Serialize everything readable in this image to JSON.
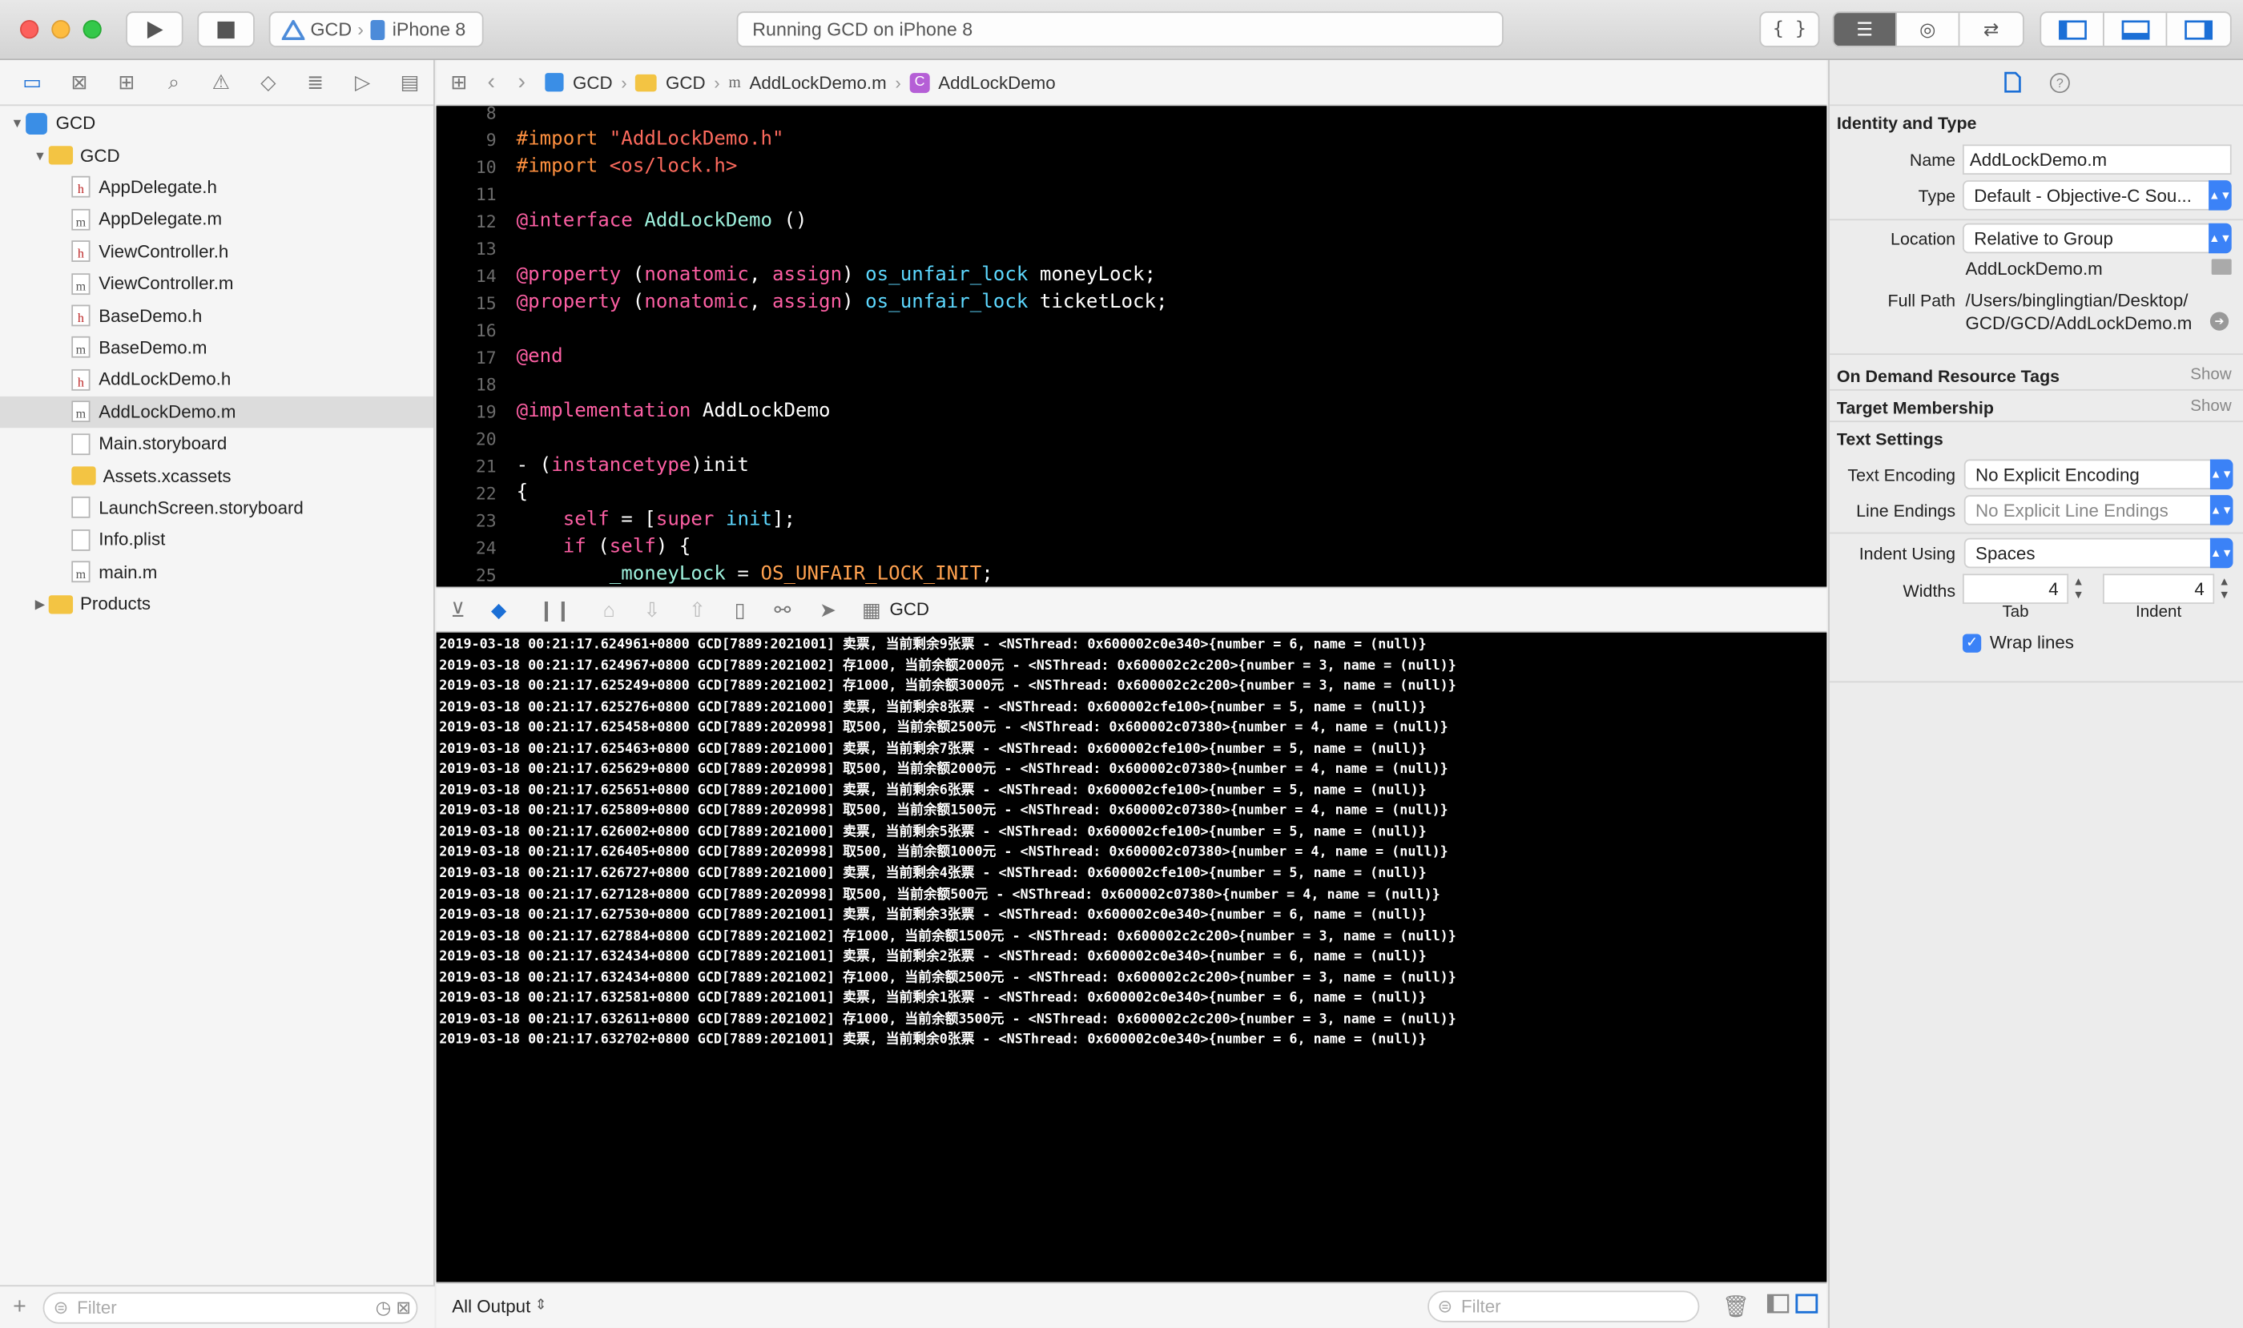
{
  "toolbar": {
    "scheme": "GCD",
    "device": "iPhone 8",
    "status": "Running GCD on iPhone 8"
  },
  "jumpbar": {
    "project": "GCD",
    "group": "GCD",
    "file": "AddLockDemo.m",
    "symbol": "AddLockDemo"
  },
  "navigator": {
    "rows": [
      {
        "label": "GCD",
        "kind": "project",
        "level": 0
      },
      {
        "label": "GCD",
        "kind": "folder",
        "level": 1
      },
      {
        "label": "AppDelegate.h",
        "kind": "h",
        "level": 2
      },
      {
        "label": "AppDelegate.m",
        "kind": "m",
        "level": 2
      },
      {
        "label": "ViewController.h",
        "kind": "h",
        "level": 2
      },
      {
        "label": "ViewController.m",
        "kind": "m",
        "level": 2
      },
      {
        "label": "BaseDemo.h",
        "kind": "h",
        "level": 2
      },
      {
        "label": "BaseDemo.m",
        "kind": "m",
        "level": 2
      },
      {
        "label": "AddLockDemo.h",
        "kind": "h",
        "level": 2
      },
      {
        "label": "AddLockDemo.m",
        "kind": "m",
        "level": 2,
        "selected": true
      },
      {
        "label": "Main.storyboard",
        "kind": "sb",
        "level": 2
      },
      {
        "label": "Assets.xcassets",
        "kind": "folder",
        "level": 2
      },
      {
        "label": "LaunchScreen.storyboard",
        "kind": "sb",
        "level": 2
      },
      {
        "label": "Info.plist",
        "kind": "sb",
        "level": 2
      },
      {
        "label": "main.m",
        "kind": "m",
        "level": 2
      },
      {
        "label": "Products",
        "kind": "folder",
        "level": 1,
        "collapsed": true
      }
    ],
    "filter_placeholder": "Filter"
  },
  "editor": {
    "lines": [
      {
        "n": "8",
        "code": ""
      },
      {
        "n": "9",
        "code": "<span class='pp'>#import</span> <span class='s'>\"AddLockDemo.h\"</span>"
      },
      {
        "n": "10",
        "code": "<span class='pp'>#import</span> <span class='s'>&lt;os/lock.h&gt;</span>"
      },
      {
        "n": "11",
        "code": ""
      },
      {
        "n": "12",
        "code": "<span class='k'>@interface</span> <span class='g'>AddLockDemo</span> ()"
      },
      {
        "n": "13",
        "code": ""
      },
      {
        "n": "14",
        "code": "<span class='k'>@property</span> (<span class='k'>nonatomic</span>, <span class='k'>assign</span>) <span class='t'>os_unfair_lock</span> moneyLock;"
      },
      {
        "n": "15",
        "code": "<span class='k'>@property</span> (<span class='k'>nonatomic</span>, <span class='k'>assign</span>) <span class='t'>os_unfair_lock</span> ticketLock;"
      },
      {
        "n": "16",
        "code": ""
      },
      {
        "n": "17",
        "code": "<span class='k'>@end</span>"
      },
      {
        "n": "18",
        "code": ""
      },
      {
        "n": "19",
        "code": "<span class='k'>@implementation</span> AddLockDemo"
      },
      {
        "n": "20",
        "code": ""
      },
      {
        "n": "21",
        "code": "- (<span class='k'>instancetype</span>)init"
      },
      {
        "n": "22",
        "code": "{"
      },
      {
        "n": "23",
        "code": "    <span class='k'>self</span> = [<span class='k'>super</span> <span class='t'>init</span>];"
      },
      {
        "n": "24",
        "code": "    <span class='k'>if</span> (<span class='k'>self</span>) {"
      },
      {
        "n": "25",
        "code": "        <span class='g'>_moneyLock</span> = <span class='y'>OS_UNFAIR_LOCK_INIT</span>;"
      }
    ]
  },
  "debug": {
    "target": "GCD"
  },
  "console": {
    "lines": [
      "2019-03-18 00:21:17.624961+0800 GCD[7889:2021001] 卖票, 当前剩余9张票 - <NSThread: 0x600002c0e340>{number = 6, name = (null)}",
      "2019-03-18 00:21:17.624967+0800 GCD[7889:2021002] 存1000, 当前余额2000元 - <NSThread: 0x600002c2c200>{number = 3, name = (null)}",
      "2019-03-18 00:21:17.625249+0800 GCD[7889:2021002] 存1000, 当前余额3000元 - <NSThread: 0x600002c2c200>{number = 3, name = (null)}",
      "2019-03-18 00:21:17.625276+0800 GCD[7889:2021000] 卖票, 当前剩余8张票 - <NSThread: 0x600002cfe100>{number = 5, name = (null)}",
      "2019-03-18 00:21:17.625458+0800 GCD[7889:2020998] 取500, 当前余额2500元 - <NSThread: 0x600002c07380>{number = 4, name = (null)}",
      "2019-03-18 00:21:17.625463+0800 GCD[7889:2021000] 卖票, 当前剩余7张票 - <NSThread: 0x600002cfe100>{number = 5, name = (null)}",
      "2019-03-18 00:21:17.625629+0800 GCD[7889:2020998] 取500, 当前余额2000元 - <NSThread: 0x600002c07380>{number = 4, name = (null)}",
      "2019-03-18 00:21:17.625651+0800 GCD[7889:2021000] 卖票, 当前剩余6张票 - <NSThread: 0x600002cfe100>{number = 5, name = (null)}",
      "2019-03-18 00:21:17.625809+0800 GCD[7889:2020998] 取500, 当前余额1500元 - <NSThread: 0x600002c07380>{number = 4, name = (null)}",
      "2019-03-18 00:21:17.626002+0800 GCD[7889:2021000] 卖票, 当前剩余5张票 - <NSThread: 0x600002cfe100>{number = 5, name = (null)}",
      "2019-03-18 00:21:17.626405+0800 GCD[7889:2020998] 取500, 当前余额1000元 - <NSThread: 0x600002c07380>{number = 4, name = (null)}",
      "2019-03-18 00:21:17.626727+0800 GCD[7889:2021000] 卖票, 当前剩余4张票 - <NSThread: 0x600002cfe100>{number = 5, name = (null)}",
      "2019-03-18 00:21:17.627128+0800 GCD[7889:2020998] 取500, 当前余额500元 - <NSThread: 0x600002c07380>{number = 4, name = (null)}",
      "2019-03-18 00:21:17.627530+0800 GCD[7889:2021001] 卖票, 当前剩余3张票 - <NSThread: 0x600002c0e340>{number = 6, name = (null)}",
      "2019-03-18 00:21:17.627884+0800 GCD[7889:2021002] 存1000, 当前余额1500元 - <NSThread: 0x600002c2c200>{number = 3, name = (null)}",
      "2019-03-18 00:21:17.632434+0800 GCD[7889:2021001] 卖票, 当前剩余2张票 - <NSThread: 0x600002c0e340>{number = 6, name = (null)}",
      "2019-03-18 00:21:17.632434+0800 GCD[7889:2021002] 存1000, 当前余额2500元 - <NSThread: 0x600002c2c200>{number = 3, name = (null)}",
      "2019-03-18 00:21:17.632581+0800 GCD[7889:2021001] 卖票, 当前剩余1张票 - <NSThread: 0x600002c0e340>{number = 6, name = (null)}",
      "2019-03-18 00:21:17.632611+0800 GCD[7889:2021002] 存1000, 当前余额3500元 - <NSThread: 0x600002c2c200>{number = 3, name = (null)}",
      "2019-03-18 00:21:17.632702+0800 GCD[7889:2021001] 卖票, 当前剩余0张票 - <NSThread: 0x600002c0e340>{number = 6, name = (null)}"
    ],
    "output_selector": "All Output",
    "filter_placeholder": "Filter"
  },
  "inspector": {
    "identity_header": "Identity and Type",
    "name_label": "Name",
    "name_value": "AddLockDemo.m",
    "type_label": "Type",
    "type_value": "Default - Objective-C Sou...",
    "location_label": "Location",
    "location_value": "Relative to Group",
    "location_file": "AddLockDemo.m",
    "fullpath_label": "Full Path",
    "fullpath_line1": "/Users/binglingtian/Desktop/",
    "fullpath_line2": "GCD/GCD/AddLockDemo.m",
    "odr_header": "On Demand Resource Tags",
    "target_header": "Target Membership",
    "show_label": "Show",
    "text_settings_header": "Text Settings",
    "encoding_label": "Text Encoding",
    "encoding_value": "No Explicit Encoding",
    "endings_label": "Line Endings",
    "endings_value": "No Explicit Line Endings",
    "indent_label": "Indent Using",
    "indent_value": "Spaces",
    "widths_label": "Widths",
    "tab_value": "4",
    "indent_width_value": "4",
    "tab_label": "Tab",
    "indent_sub_label": "Indent",
    "wrap_label": "Wrap lines",
    "wrap_checked": true
  },
  "colors": {
    "accent": "#3b82f7",
    "editor_bg": "#000000"
  }
}
